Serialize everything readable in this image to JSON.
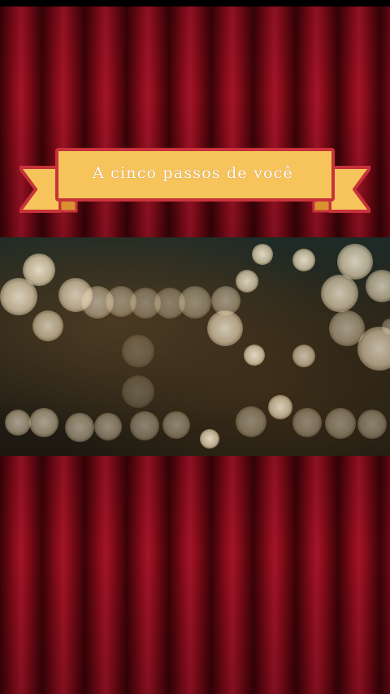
{
  "banner": {
    "title": "A cinco passos de você"
  },
  "colors": {
    "curtain": "#8a0d1a",
    "banner_fill": "#f6c45a",
    "banner_border": "#c8323a",
    "bokeh": "#fff2d6"
  }
}
